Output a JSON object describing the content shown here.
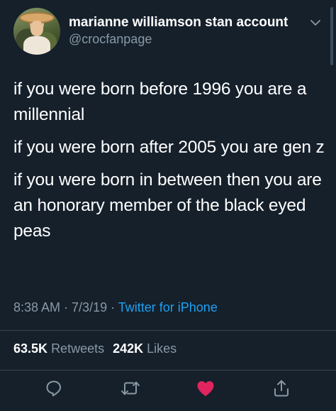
{
  "user": {
    "display_name": "marianne williamson stan account",
    "handle": "@crocfanpage"
  },
  "tweet": {
    "paragraphs": [
      "if you were born before 1996 you are a millennial",
      "if you were born after 2005 you are gen z",
      "if you were born in between then you are an honorary member of the black eyed peas"
    ]
  },
  "meta": {
    "time": "8:38 AM",
    "sep1": " · ",
    "date": "7/3/19",
    "sep2": " · ",
    "source": "Twitter for iPhone"
  },
  "stats": {
    "retweets_count": "63.5K",
    "retweets_label": "Retweets",
    "likes_count": "242K",
    "likes_label": "Likes"
  },
  "actions": {
    "reply_icon": "reply-icon",
    "retweet_icon": "retweet-icon",
    "like_icon": "heart-icon",
    "share_icon": "share-icon"
  },
  "colors": {
    "background": "#15202b",
    "secondary_text": "#8899a6",
    "link": "#1da1f2",
    "liked_heart": "#e0245e",
    "icon": "#8899a6"
  }
}
